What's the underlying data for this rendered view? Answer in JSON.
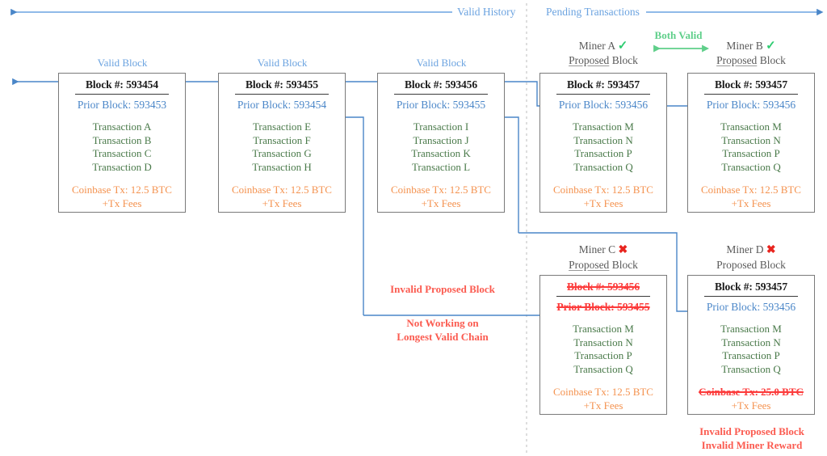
{
  "header": {
    "valid_history_label": "Valid History",
    "pending_label": "Pending Transactions"
  },
  "colors": {
    "blue": "#4a86c8",
    "light_blue": "#6ba3e0",
    "green_tx": "#4a7a4a",
    "orange": "#f4924f",
    "red": "#fb5b50",
    "check_green": "#2ecc71",
    "cross_red": "#e8251f",
    "block_border": "#7a7a7a"
  },
  "captions": {
    "valid_block": "Valid Block",
    "proposed_underlined": "Proposed",
    "proposed_rest": " Block",
    "check_icon": "✓",
    "cross_icon": "✖",
    "both_valid": "Both Valid",
    "miner_a": "Miner A",
    "miner_b": "Miner B",
    "miner_c": "Miner C",
    "miner_d": "Miner D"
  },
  "notes": {
    "invalid_proposed_block": "Invalid Proposed Block",
    "not_working_l1": "Not Working on",
    "not_working_l2": "Longest Valid Chain",
    "invalid_reward_l1": "Invalid Proposed Block",
    "invalid_reward_l2": "Invalid Miner Reward"
  },
  "blocks": [
    {
      "id": "block-593454",
      "caption": "Valid Block",
      "number": "Block #: 593454",
      "prior": "Prior Block: 593453",
      "transactions": [
        "Transaction A",
        "Transaction B",
        "Transaction C",
        "Transaction D"
      ],
      "coinbase": "Coinbase Tx: 12.5 BTC",
      "fees": "+Tx Fees",
      "number_invalid": false,
      "prior_invalid": false,
      "coinbase_invalid": false
    },
    {
      "id": "block-593455",
      "caption": "Valid Block",
      "number": "Block #: 593455",
      "prior": "Prior Block: 593454",
      "transactions": [
        "Transaction E",
        "Transaction F",
        "Transaction G",
        "Transaction H"
      ],
      "coinbase": "Coinbase Tx: 12.5 BTC",
      "fees": "+Tx Fees",
      "number_invalid": false,
      "prior_invalid": false,
      "coinbase_invalid": false
    },
    {
      "id": "block-593456",
      "caption": "Valid Block",
      "number": "Block #: 593456",
      "prior": "Prior Block: 593455",
      "transactions": [
        "Transaction I",
        "Transaction J",
        "Transaction K",
        "Transaction L"
      ],
      "coinbase": "Coinbase Tx: 12.5 BTC",
      "fees": "+Tx Fees",
      "number_invalid": false,
      "prior_invalid": false,
      "coinbase_invalid": false
    },
    {
      "id": "miner-a-block",
      "caption": "Miner A",
      "number": "Block #: 593457",
      "prior": "Prior Block: 593456",
      "transactions": [
        "Transaction M",
        "Transaction N",
        "Transaction P",
        "Transaction Q"
      ],
      "coinbase": "Coinbase Tx: 12.5 BTC",
      "fees": "+Tx Fees",
      "number_invalid": false,
      "prior_invalid": false,
      "coinbase_invalid": false
    },
    {
      "id": "miner-b-block",
      "caption": "Miner B",
      "number": "Block #: 593457",
      "prior": "Prior Block: 593456",
      "transactions": [
        "Transaction M",
        "Transaction N",
        "Transaction P",
        "Transaction Q"
      ],
      "coinbase": "Coinbase Tx: 12.5 BTC",
      "fees": "+Tx Fees",
      "number_invalid": false,
      "prior_invalid": false,
      "coinbase_invalid": false
    },
    {
      "id": "miner-c-block",
      "caption": "Miner C",
      "number": "Block #: 593456",
      "prior": "Prior Block: 593455",
      "transactions": [
        "Transaction M",
        "Transaction N",
        "Transaction P",
        "Transaction Q"
      ],
      "coinbase": "Coinbase Tx: 12.5 BTC",
      "fees": "+Tx Fees",
      "number_invalid": true,
      "prior_invalid": true,
      "coinbase_invalid": false
    },
    {
      "id": "miner-d-block",
      "caption": "Miner D",
      "number": "Block #: 593457",
      "prior": "Prior Block: 593456",
      "transactions": [
        "Transaction M",
        "Transaction N",
        "Transaction P",
        "Transaction Q"
      ],
      "coinbase": "Coinbase Tx: 25.0 BTC",
      "fees": "+Tx Fees",
      "number_invalid": false,
      "prior_invalid": false,
      "coinbase_invalid": true
    }
  ]
}
